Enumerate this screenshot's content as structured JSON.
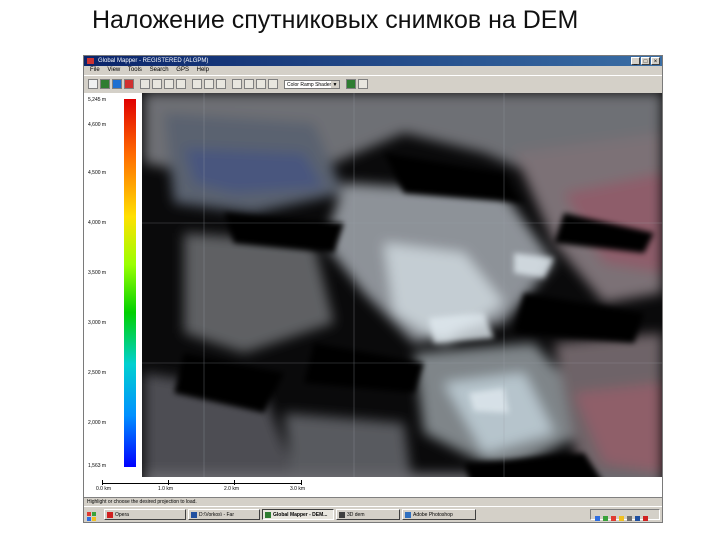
{
  "slide": {
    "title": "Наложение спутниковых снимков на DEM"
  },
  "window": {
    "title": "Global Mapper - REGISTERED (ALGPM)",
    "buttons": [
      "_",
      "□",
      "×"
    ]
  },
  "menu": [
    "File",
    "View",
    "Tools",
    "Search",
    "GPS",
    "Help"
  ],
  "toolbar": {
    "shader_select": "Color Ramp Shader"
  },
  "legend": {
    "labels": [
      "5,245 m",
      "4,600 m",
      "4,500 m",
      "4,000 m",
      "3,500 m",
      "3,000 m",
      "2,500 m",
      "2,000 m",
      "1,563 m"
    ],
    "colors": [
      "#e00000",
      "#ff6a00",
      "#ffe000",
      "#9aff00",
      "#00d000",
      "#00d0d0",
      "#0090ff",
      "#0000ff"
    ]
  },
  "scale": {
    "labels": [
      "0.0 km",
      "1.0 km",
      "2.0 km",
      "3.0 km"
    ]
  },
  "status": {
    "text": "Highlight or choose the desired projection to load."
  },
  "taskbar": {
    "tasks": [
      "Opera",
      "D:\\Vorkos\\ - Far",
      "Global Mapper - DEM...",
      "3D dem",
      "Adobe Photoshop"
    ],
    "active_index": 2
  }
}
